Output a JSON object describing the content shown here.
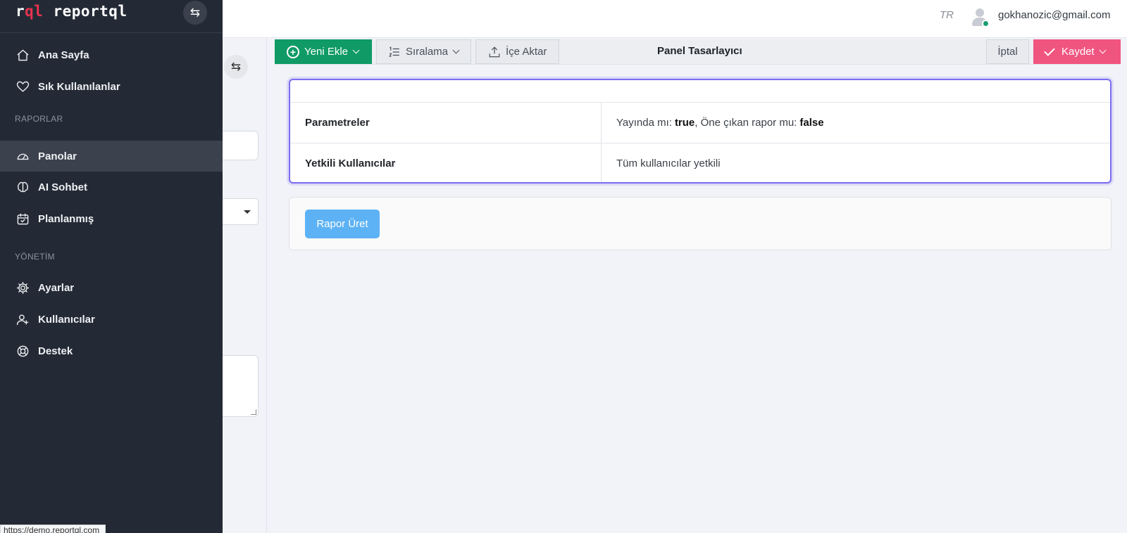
{
  "header": {
    "language": "TR",
    "user_email": "gokhanozic@gmail.com"
  },
  "sidebar": {
    "brand_short": "rql",
    "brand_name": "reportql",
    "items_main": [
      {
        "label": "Ana Sayfa",
        "icon": "home-icon"
      },
      {
        "label": "Sık Kullanılanlar",
        "icon": "heart-icon"
      }
    ],
    "section_reports": "RAPORLAR",
    "items_reports": [
      {
        "label": "Panolar",
        "icon": "dashboard-icon",
        "active": true
      },
      {
        "label": "AI Sohbet",
        "icon": "brain-icon"
      },
      {
        "label": "Planlanmış",
        "icon": "calendar-check-icon"
      }
    ],
    "section_admin": "YÖNETİM",
    "items_admin": [
      {
        "label": "Ayarlar",
        "icon": "gear-icon"
      },
      {
        "label": "Kullanıcılar",
        "icon": "user-add-icon"
      },
      {
        "label": "Destek",
        "icon": "lifebuoy-icon"
      }
    ],
    "accent_color": "#e8334f",
    "background_color": "#232a35"
  },
  "status_bar_url": "https://demo.reportql.com",
  "toolbar": {
    "add_label": "Yeni Ekle",
    "sort_label": "Sıralama",
    "import_label": "İçe Aktar",
    "title": "Panel Tasarlayıcı",
    "cancel_label": "İptal",
    "save_label": "Kaydet",
    "add_color": "#0f9a66",
    "save_color": "#f0557f"
  },
  "params_table": {
    "rows": [
      {
        "key": "Parametreler",
        "value_prefix": "Yayında mı:",
        "value_bold1": "true",
        "value_middle": ", Öne çıkan rapor mu:",
        "value_bold2": "false"
      },
      {
        "key": "Yetkili Kullanıcılar",
        "value": "Tüm kullanıcılar yetkili"
      }
    ]
  },
  "actions": {
    "generate_label": "Rapor Üret",
    "generate_color": "#5db2f5"
  }
}
